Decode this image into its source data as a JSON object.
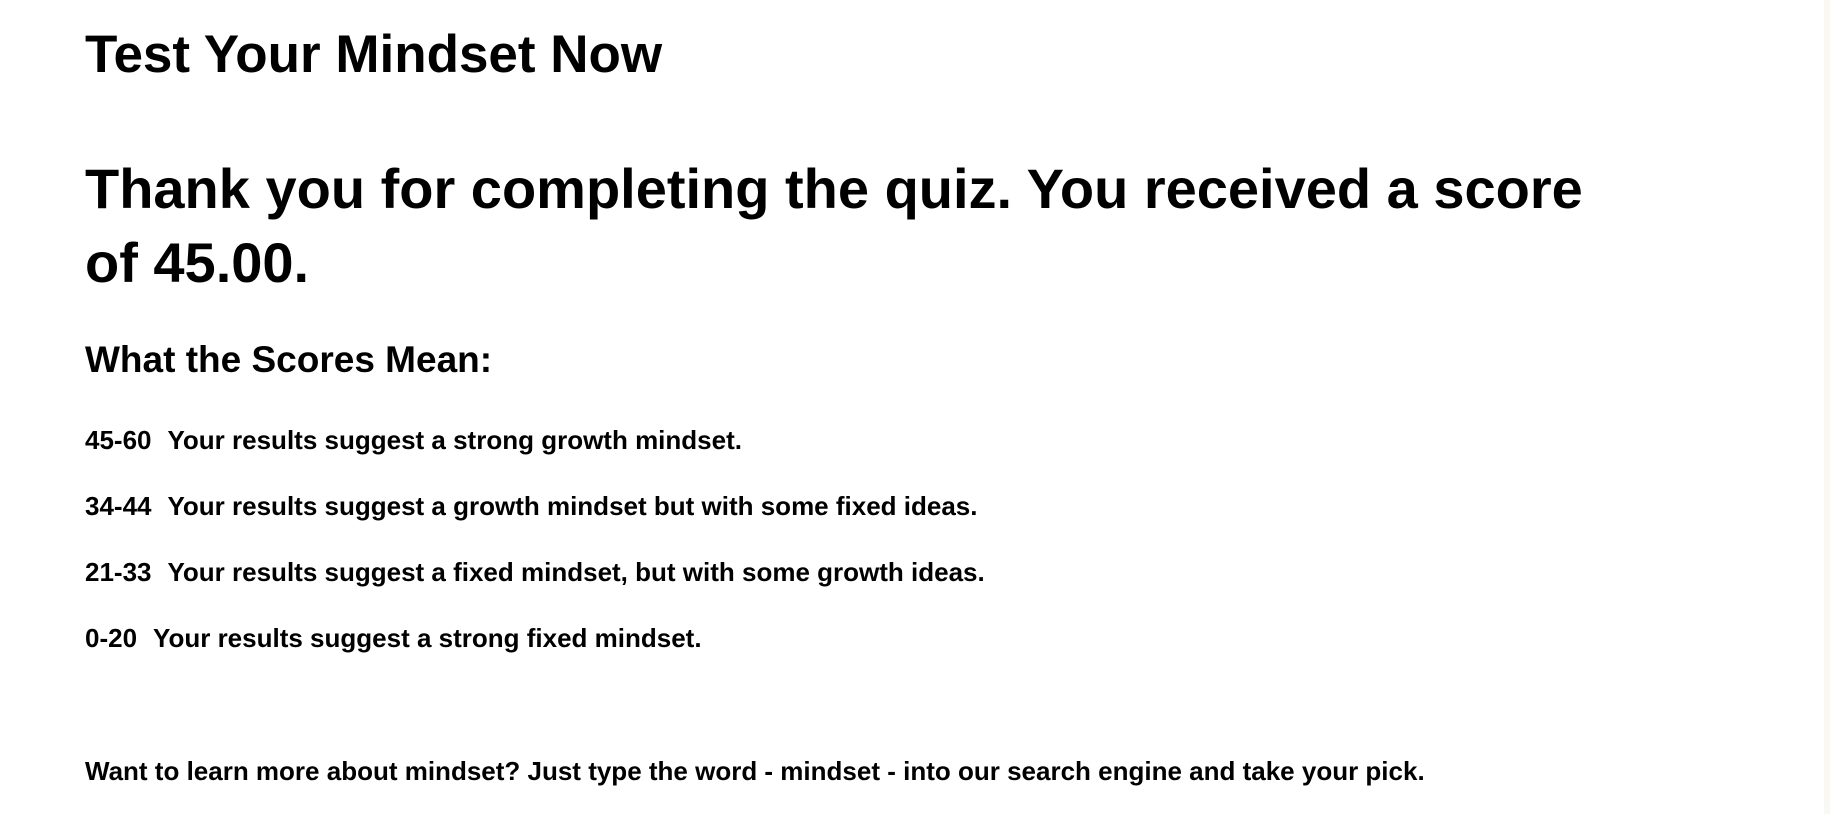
{
  "page": {
    "title": "Test Your Mindset Now",
    "result_message": "Thank you for completing the quiz. You received a score of 45.00.",
    "section_heading": "What the Scores Mean:",
    "score_ranges": [
      {
        "range": "45-60",
        "description": "Your results suggest a strong growth mindset."
      },
      {
        "range": "34-44",
        "description": "Your results suggest a growth mindset but with some fixed ideas."
      },
      {
        "range": "21-33",
        "description": "Your results suggest a fixed mindset, but with some growth ideas."
      },
      {
        "range": "0-20",
        "description": "Your results suggest a strong fixed mindset."
      }
    ],
    "footer": "Want to learn more about mindset? Just type the word - mindset - into our search engine and take your pick."
  },
  "colors": {
    "background": "#ffffff",
    "text": "#000000",
    "edge_strip": "#faf8f2"
  }
}
